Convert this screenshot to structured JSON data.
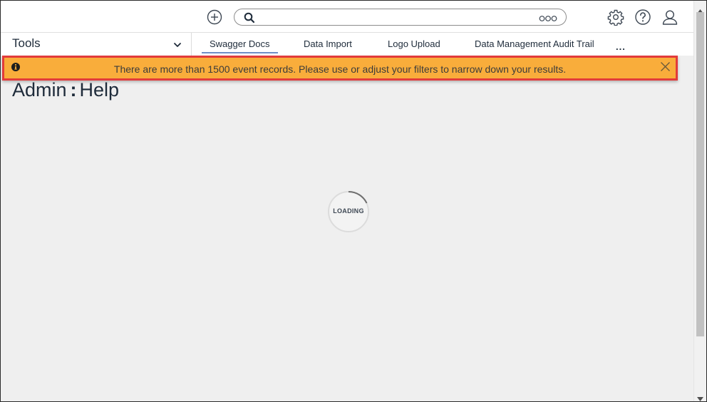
{
  "header": {
    "add_icon": "plus-circle-icon",
    "search": {
      "value": "",
      "placeholder": "",
      "icon": "search-icon",
      "options_icon": "more-options-icon"
    },
    "settings_icon": "gear-icon",
    "help_icon": "question-circle-icon",
    "profile_icon": "user-icon"
  },
  "nav": {
    "tools_label": "Tools",
    "tabs": [
      {
        "label": "Swagger Docs",
        "active": true
      },
      {
        "label": "Data Import",
        "active": false
      },
      {
        "label": "Logo Upload",
        "active": false
      },
      {
        "label": "Data Management Audit Trail",
        "active": false
      }
    ],
    "more_label": "..."
  },
  "banner": {
    "text": "There are more than 1500 event records. Please use or adjust your filters to narrow down your results.",
    "icon": "info-icon",
    "close_icon": "close-icon",
    "color": "#f9ad3b",
    "highlight_color": "#e23b3b"
  },
  "page": {
    "title_section": "Admin",
    "title_separator": ":",
    "title_page": "Help"
  },
  "loading": {
    "label": "LOADING"
  },
  "colors": {
    "background": "#efefef",
    "text": "#1e2b3a",
    "active_tab_underline": "#6e8fc7"
  }
}
